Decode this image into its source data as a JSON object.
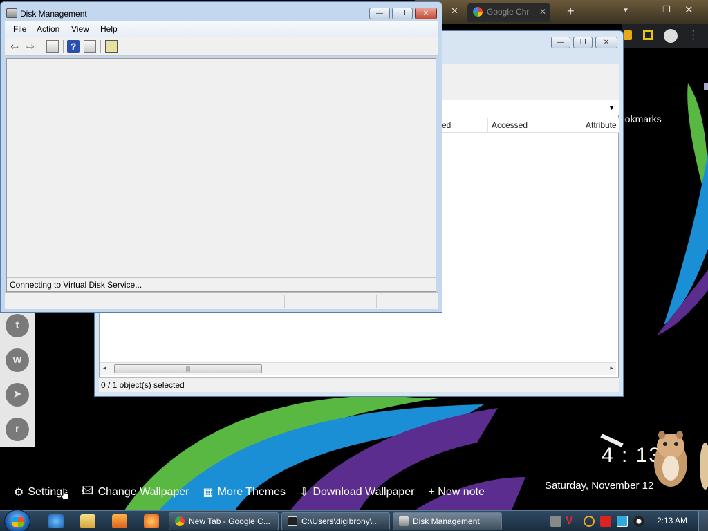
{
  "colors": {
    "swirl_green": "#59b841",
    "swirl_blue": "#1a8fd6",
    "swirl_purple": "#5b2d8e",
    "taskbar": "#24394d"
  },
  "browser": {
    "tab_label": "Google Chr",
    "bookmarks_fragment": "ookmarks",
    "links": [
      {
        "icon": "gear-icon",
        "label": "Settings"
      },
      {
        "icon": "picture-icon",
        "label": "Change Wallpaper"
      },
      {
        "icon": "grid-icon",
        "label": "More Themes"
      },
      {
        "icon": "download-icon",
        "label": "Download Wallpaper"
      },
      {
        "icon": "plus-icon",
        "label": "+ New note"
      }
    ],
    "clock": "4 : 13",
    "date": "Saturday, November 12"
  },
  "explorer": {
    "columns": [
      "ed",
      "Accessed",
      "Attribute"
    ],
    "status": "0 / 1 object(s) selected"
  },
  "disk_management": {
    "title": "Disk Management",
    "menu": [
      "File",
      "Action",
      "View",
      "Help"
    ],
    "message": "Connecting to Virtual Disk Service..."
  },
  "taskbar": {
    "tasks": [
      "New Tab - Google C...",
      "C:\\Users\\digibrony\\...",
      "Disk Management"
    ],
    "time": "2:13 AM"
  }
}
